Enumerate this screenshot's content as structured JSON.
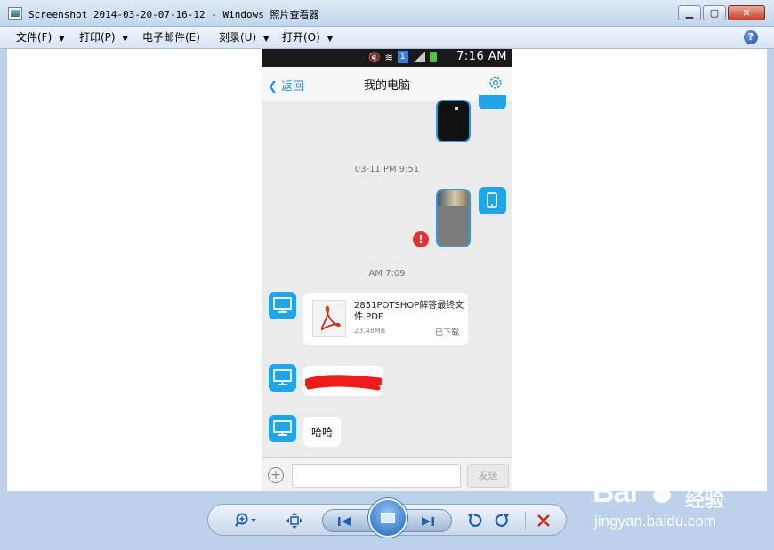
{
  "window": {
    "title": "Screenshot_2014-03-20-07-16-12 - Windows 照片查看器"
  },
  "menu": {
    "items": [
      {
        "label": "文件(F)"
      },
      {
        "label": "打印(P)"
      },
      {
        "label": "电子邮件(E)"
      },
      {
        "label": "刻录(U)"
      },
      {
        "label": "打开(O)"
      }
    ],
    "help_icon": "help-icon"
  },
  "phone": {
    "status": {
      "sim": "1",
      "time": "7:16 AM",
      "battery_color": "#57c23a"
    },
    "nav": {
      "back_label": "返回",
      "title": "我的电脑",
      "settings_icon": "gear-icon"
    },
    "timestamps": [
      "03-11 PM 9:51",
      "AM 7:09"
    ],
    "file_message": {
      "name": "2851POTSHOP解答最终文件.PDF",
      "size": "23.48MB",
      "status": "已下载"
    },
    "text_message": "哈哈",
    "error_glyph": "!",
    "input": {
      "placeholder": "",
      "send_label": "发送"
    },
    "accent": "#1fa6ea"
  },
  "controls": {
    "icons": [
      "zoom-icon",
      "fit-icon",
      "previous-icon",
      "slideshow-icon",
      "next-icon",
      "rotate-left-icon",
      "rotate-right-icon",
      "delete-icon"
    ]
  },
  "watermark": {
    "brand": "Bai",
    "brand_cn": "经验",
    "url": "jingyan.baidu.com"
  }
}
